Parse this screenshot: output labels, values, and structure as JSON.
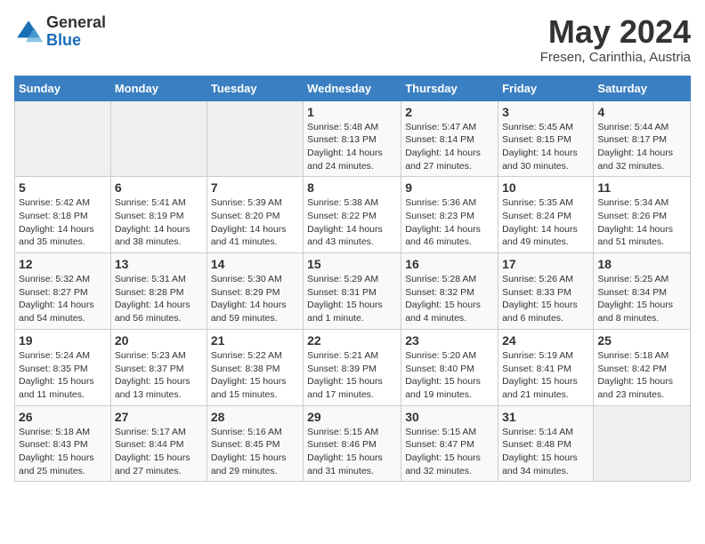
{
  "header": {
    "logo": {
      "general": "General",
      "blue": "Blue"
    },
    "title": "May 2024",
    "location": "Fresen, Carinthia, Austria"
  },
  "calendar": {
    "days_of_week": [
      "Sunday",
      "Monday",
      "Tuesday",
      "Wednesday",
      "Thursday",
      "Friday",
      "Saturday"
    ],
    "weeks": [
      [
        {
          "day": "",
          "info": ""
        },
        {
          "day": "",
          "info": ""
        },
        {
          "day": "",
          "info": ""
        },
        {
          "day": "1",
          "info": "Sunrise: 5:48 AM\nSunset: 8:13 PM\nDaylight: 14 hours\nand 24 minutes."
        },
        {
          "day": "2",
          "info": "Sunrise: 5:47 AM\nSunset: 8:14 PM\nDaylight: 14 hours\nand 27 minutes."
        },
        {
          "day": "3",
          "info": "Sunrise: 5:45 AM\nSunset: 8:15 PM\nDaylight: 14 hours\nand 30 minutes."
        },
        {
          "day": "4",
          "info": "Sunrise: 5:44 AM\nSunset: 8:17 PM\nDaylight: 14 hours\nand 32 minutes."
        }
      ],
      [
        {
          "day": "5",
          "info": "Sunrise: 5:42 AM\nSunset: 8:18 PM\nDaylight: 14 hours\nand 35 minutes."
        },
        {
          "day": "6",
          "info": "Sunrise: 5:41 AM\nSunset: 8:19 PM\nDaylight: 14 hours\nand 38 minutes."
        },
        {
          "day": "7",
          "info": "Sunrise: 5:39 AM\nSunset: 8:20 PM\nDaylight: 14 hours\nand 41 minutes."
        },
        {
          "day": "8",
          "info": "Sunrise: 5:38 AM\nSunset: 8:22 PM\nDaylight: 14 hours\nand 43 minutes."
        },
        {
          "day": "9",
          "info": "Sunrise: 5:36 AM\nSunset: 8:23 PM\nDaylight: 14 hours\nand 46 minutes."
        },
        {
          "day": "10",
          "info": "Sunrise: 5:35 AM\nSunset: 8:24 PM\nDaylight: 14 hours\nand 49 minutes."
        },
        {
          "day": "11",
          "info": "Sunrise: 5:34 AM\nSunset: 8:26 PM\nDaylight: 14 hours\nand 51 minutes."
        }
      ],
      [
        {
          "day": "12",
          "info": "Sunrise: 5:32 AM\nSunset: 8:27 PM\nDaylight: 14 hours\nand 54 minutes."
        },
        {
          "day": "13",
          "info": "Sunrise: 5:31 AM\nSunset: 8:28 PM\nDaylight: 14 hours\nand 56 minutes."
        },
        {
          "day": "14",
          "info": "Sunrise: 5:30 AM\nSunset: 8:29 PM\nDaylight: 14 hours\nand 59 minutes."
        },
        {
          "day": "15",
          "info": "Sunrise: 5:29 AM\nSunset: 8:31 PM\nDaylight: 15 hours\nand 1 minute."
        },
        {
          "day": "16",
          "info": "Sunrise: 5:28 AM\nSunset: 8:32 PM\nDaylight: 15 hours\nand 4 minutes."
        },
        {
          "day": "17",
          "info": "Sunrise: 5:26 AM\nSunset: 8:33 PM\nDaylight: 15 hours\nand 6 minutes."
        },
        {
          "day": "18",
          "info": "Sunrise: 5:25 AM\nSunset: 8:34 PM\nDaylight: 15 hours\nand 8 minutes."
        }
      ],
      [
        {
          "day": "19",
          "info": "Sunrise: 5:24 AM\nSunset: 8:35 PM\nDaylight: 15 hours\nand 11 minutes."
        },
        {
          "day": "20",
          "info": "Sunrise: 5:23 AM\nSunset: 8:37 PM\nDaylight: 15 hours\nand 13 minutes."
        },
        {
          "day": "21",
          "info": "Sunrise: 5:22 AM\nSunset: 8:38 PM\nDaylight: 15 hours\nand 15 minutes."
        },
        {
          "day": "22",
          "info": "Sunrise: 5:21 AM\nSunset: 8:39 PM\nDaylight: 15 hours\nand 17 minutes."
        },
        {
          "day": "23",
          "info": "Sunrise: 5:20 AM\nSunset: 8:40 PM\nDaylight: 15 hours\nand 19 minutes."
        },
        {
          "day": "24",
          "info": "Sunrise: 5:19 AM\nSunset: 8:41 PM\nDaylight: 15 hours\nand 21 minutes."
        },
        {
          "day": "25",
          "info": "Sunrise: 5:18 AM\nSunset: 8:42 PM\nDaylight: 15 hours\nand 23 minutes."
        }
      ],
      [
        {
          "day": "26",
          "info": "Sunrise: 5:18 AM\nSunset: 8:43 PM\nDaylight: 15 hours\nand 25 minutes."
        },
        {
          "day": "27",
          "info": "Sunrise: 5:17 AM\nSunset: 8:44 PM\nDaylight: 15 hours\nand 27 minutes."
        },
        {
          "day": "28",
          "info": "Sunrise: 5:16 AM\nSunset: 8:45 PM\nDaylight: 15 hours\nand 29 minutes."
        },
        {
          "day": "29",
          "info": "Sunrise: 5:15 AM\nSunset: 8:46 PM\nDaylight: 15 hours\nand 31 minutes."
        },
        {
          "day": "30",
          "info": "Sunrise: 5:15 AM\nSunset: 8:47 PM\nDaylight: 15 hours\nand 32 minutes."
        },
        {
          "day": "31",
          "info": "Sunrise: 5:14 AM\nSunset: 8:48 PM\nDaylight: 15 hours\nand 34 minutes."
        },
        {
          "day": "",
          "info": ""
        }
      ]
    ]
  }
}
